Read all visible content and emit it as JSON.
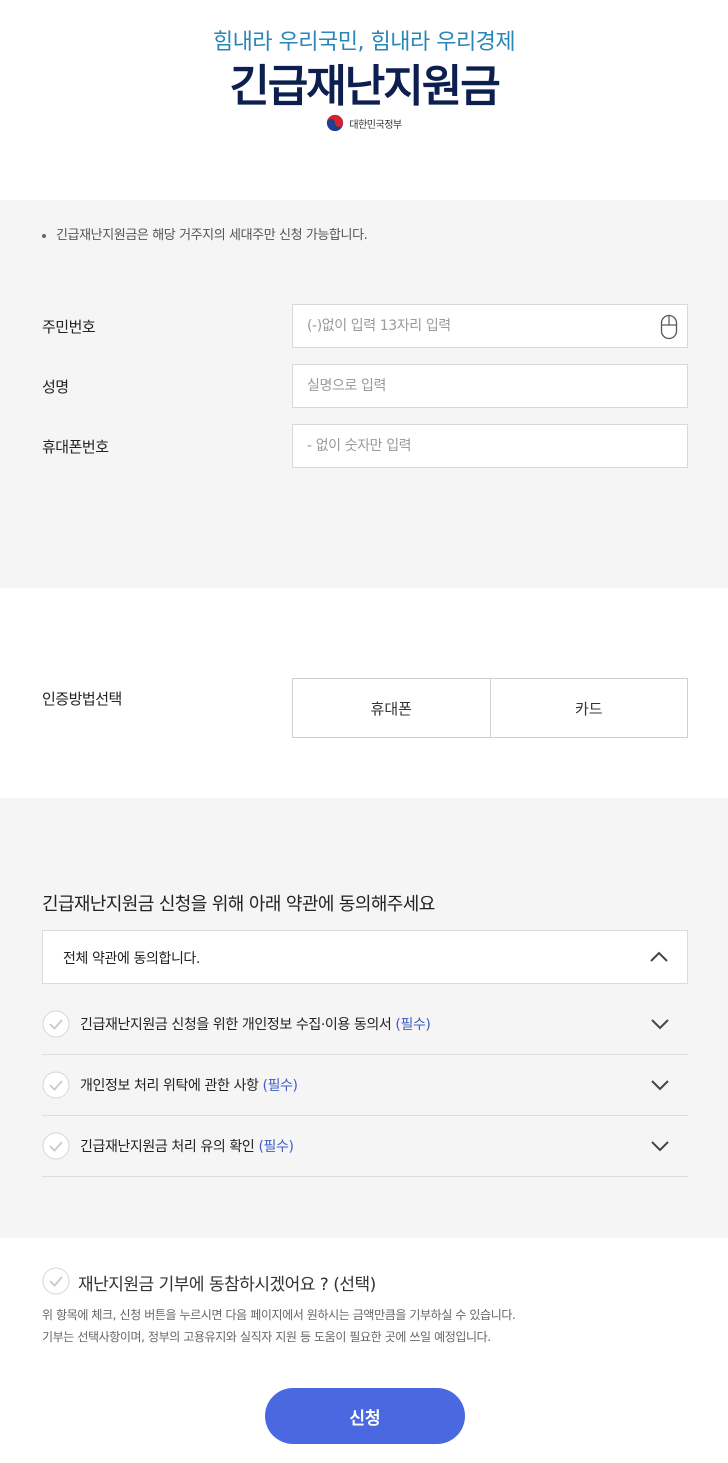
{
  "header": {
    "slogan": "힘내라 우리국민, 힘내라 우리경제",
    "title": "긴급재난지원금",
    "gov_label": "대한민국정부",
    "emblem_icon": "taegeuk-icon"
  },
  "notice": "긴급재난지원금은 해당 거주지의 세대주만 신청 가능합니다.",
  "form": {
    "rrn": {
      "label": "주민번호",
      "placeholder": "(-)없이 입력 13자리 입력",
      "icon": "mouse-icon"
    },
    "name": {
      "label": "성명",
      "placeholder": "실명으로 입력"
    },
    "phone": {
      "label": "휴대폰번호",
      "placeholder": "- 없이 숫자만 입력"
    }
  },
  "auth": {
    "label": "인증방법선택",
    "options": [
      "휴대폰",
      "카드"
    ]
  },
  "terms": {
    "heading": "긴급재난지원금 신청을 위해 아래 약관에 동의해주세요",
    "all_agree": "전체 약관에 동의합니다.",
    "items": [
      {
        "text": "긴급재난지원금 신청을 위한 개인정보 수집·이용 동의서",
        "tag": "(필수)"
      },
      {
        "text": "개인정보 처리 위탁에 관한 사항",
        "tag": "(필수)"
      },
      {
        "text": "긴급재난지원금 처리 유의 확인",
        "tag": "(필수)"
      }
    ]
  },
  "donation": {
    "title": "재난지원금 기부에 동참하시겠어요 ? (선택)",
    "desc1": "위 항목에 체크, 신청 버튼을 누르시면 다음 페이지에서 원하시는 금액만큼을 기부하실 수 있습니다.",
    "desc2": "기부는 선택사항이며, 정부의 고용유지와 실직자 지원 등 도움이 필요한 곳에 쓰일 예정입니다."
  },
  "submit_label": "신청",
  "colors": {
    "accent": "#4a68e0",
    "slogan": "#2a86b8",
    "title": "#0d1f4f",
    "required": "#3f5ec8"
  }
}
